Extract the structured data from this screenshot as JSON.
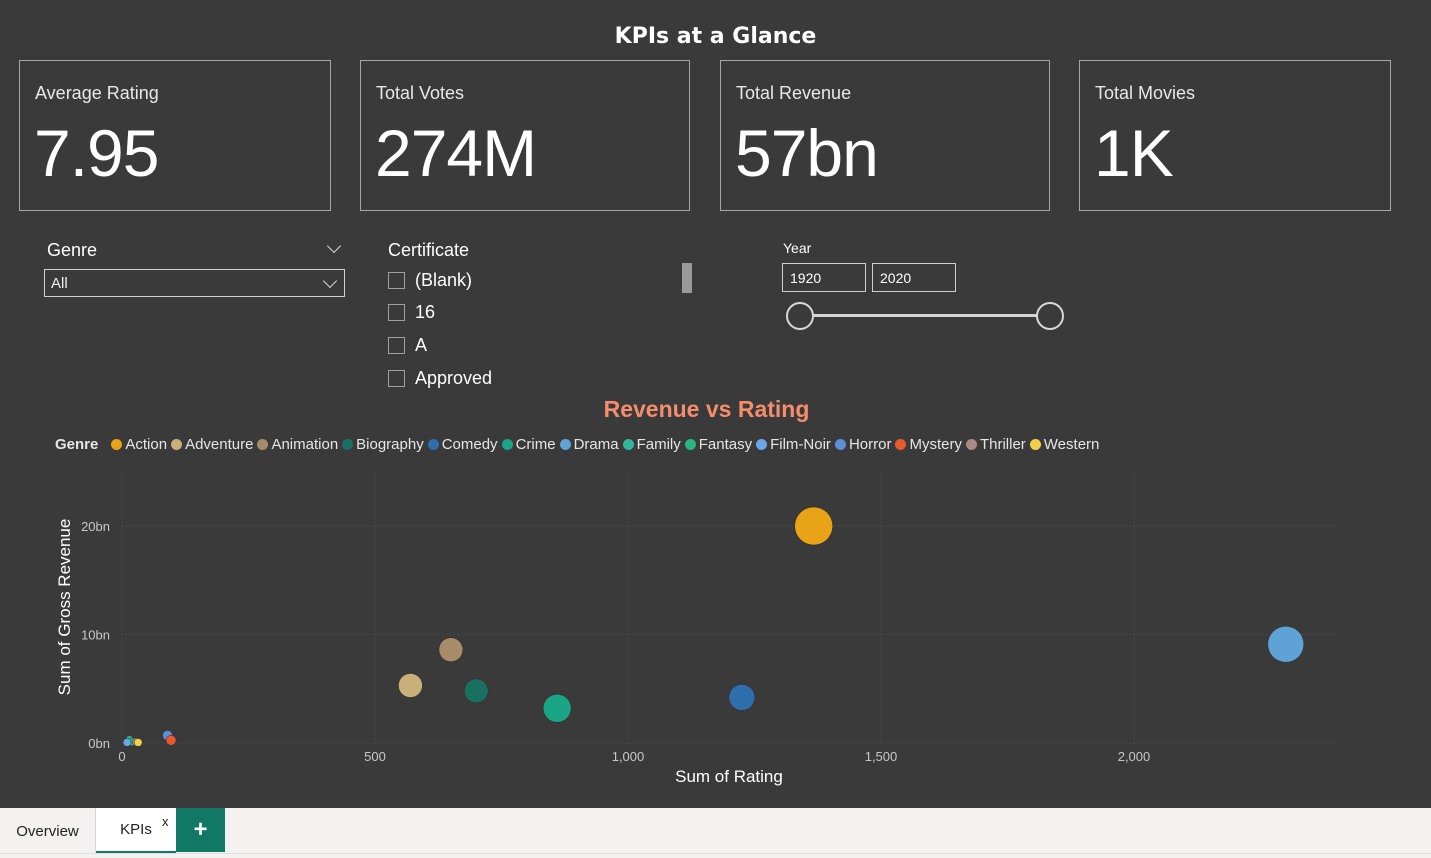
{
  "page_title": "KPIs at a Glance",
  "kpis": [
    {
      "label": "Average Rating",
      "value": "7.95"
    },
    {
      "label": "Total Votes",
      "value": "274M"
    },
    {
      "label": "Total Revenue",
      "value": "57bn"
    },
    {
      "label": "Total Movies",
      "value": "1K"
    }
  ],
  "genre_slicer": {
    "title": "Genre",
    "selected": "All"
  },
  "certificate_slicer": {
    "title": "Certificate",
    "items": [
      "(Blank)",
      "16",
      "A",
      "Approved"
    ]
  },
  "year_slicer": {
    "title": "Year",
    "from": "1920",
    "to": "2020"
  },
  "colors": {
    "background": "#3a3a3a",
    "chart_title": "#f58d6c",
    "tab_accent": "#117865"
  },
  "chart_data": {
    "type": "scatter",
    "title": "Revenue vs Rating",
    "xlabel": "Sum of Rating",
    "ylabel": "Sum of Gross Revenue",
    "legend_title": "Genre",
    "legend_placement": "top-left",
    "xlim": [
      0,
      2400
    ],
    "ylim": [
      0,
      25
    ],
    "x_ticks": [
      {
        "v": 0,
        "label": "0"
      },
      {
        "v": 500,
        "label": "500"
      },
      {
        "v": 1000,
        "label": "1,000"
      },
      {
        "v": 1500,
        "label": "1,500"
      },
      {
        "v": 2000,
        "label": "2,000"
      }
    ],
    "y_ticks": [
      {
        "v": 0,
        "label": "0bn"
      },
      {
        "v": 10,
        "label": "10bn"
      },
      {
        "v": 20,
        "label": "20bn"
      }
    ],
    "grid": true,
    "series": [
      {
        "name": "Action",
        "color": "#e8a317",
        "x": 1367,
        "y": 20.0,
        "r": 19
      },
      {
        "name": "Adventure",
        "color": "#c8b078",
        "x": 570,
        "y": 5.3,
        "r": 12
      },
      {
        "name": "Animation",
        "color": "#a88c6a",
        "x": 650,
        "y": 8.6,
        "r": 12
      },
      {
        "name": "Biography",
        "color": "#1a7060",
        "x": 700,
        "y": 4.8,
        "r": 12
      },
      {
        "name": "Comedy",
        "color": "#2f6ead",
        "x": 1225,
        "y": 4.2,
        "r": 13
      },
      {
        "name": "Crime",
        "color": "#1aa584",
        "x": 860,
        "y": 3.2,
        "r": 14
      },
      {
        "name": "Drama",
        "color": "#5fa2d6",
        "x": 2300,
        "y": 9.1,
        "r": 18
      },
      {
        "name": "Family",
        "color": "#30b89a",
        "x": 15,
        "y": 0.3,
        "r": 4
      },
      {
        "name": "Fantasy",
        "color": "#28b685",
        "x": 20,
        "y": 0.1,
        "r": 4
      },
      {
        "name": "Film-Noir",
        "color": "#6aa6e8",
        "x": 10,
        "y": 0.05,
        "r": 4
      },
      {
        "name": "Horror",
        "color": "#5c8fd6",
        "x": 90,
        "y": 0.7,
        "r": 5
      },
      {
        "name": "Mystery",
        "color": "#e85a2e",
        "x": 97,
        "y": 0.25,
        "r": 5
      },
      {
        "name": "Thriller",
        "color": "#a88a80",
        "x": 28,
        "y": 0.1,
        "r": 4
      },
      {
        "name": "Western",
        "color": "#f2d04a",
        "x": 32,
        "y": 0.05,
        "r": 4
      }
    ]
  },
  "tabs": [
    {
      "label": "Overview"
    },
    {
      "label": "KPIs"
    }
  ],
  "tab_close": "x",
  "tab_add": "+"
}
